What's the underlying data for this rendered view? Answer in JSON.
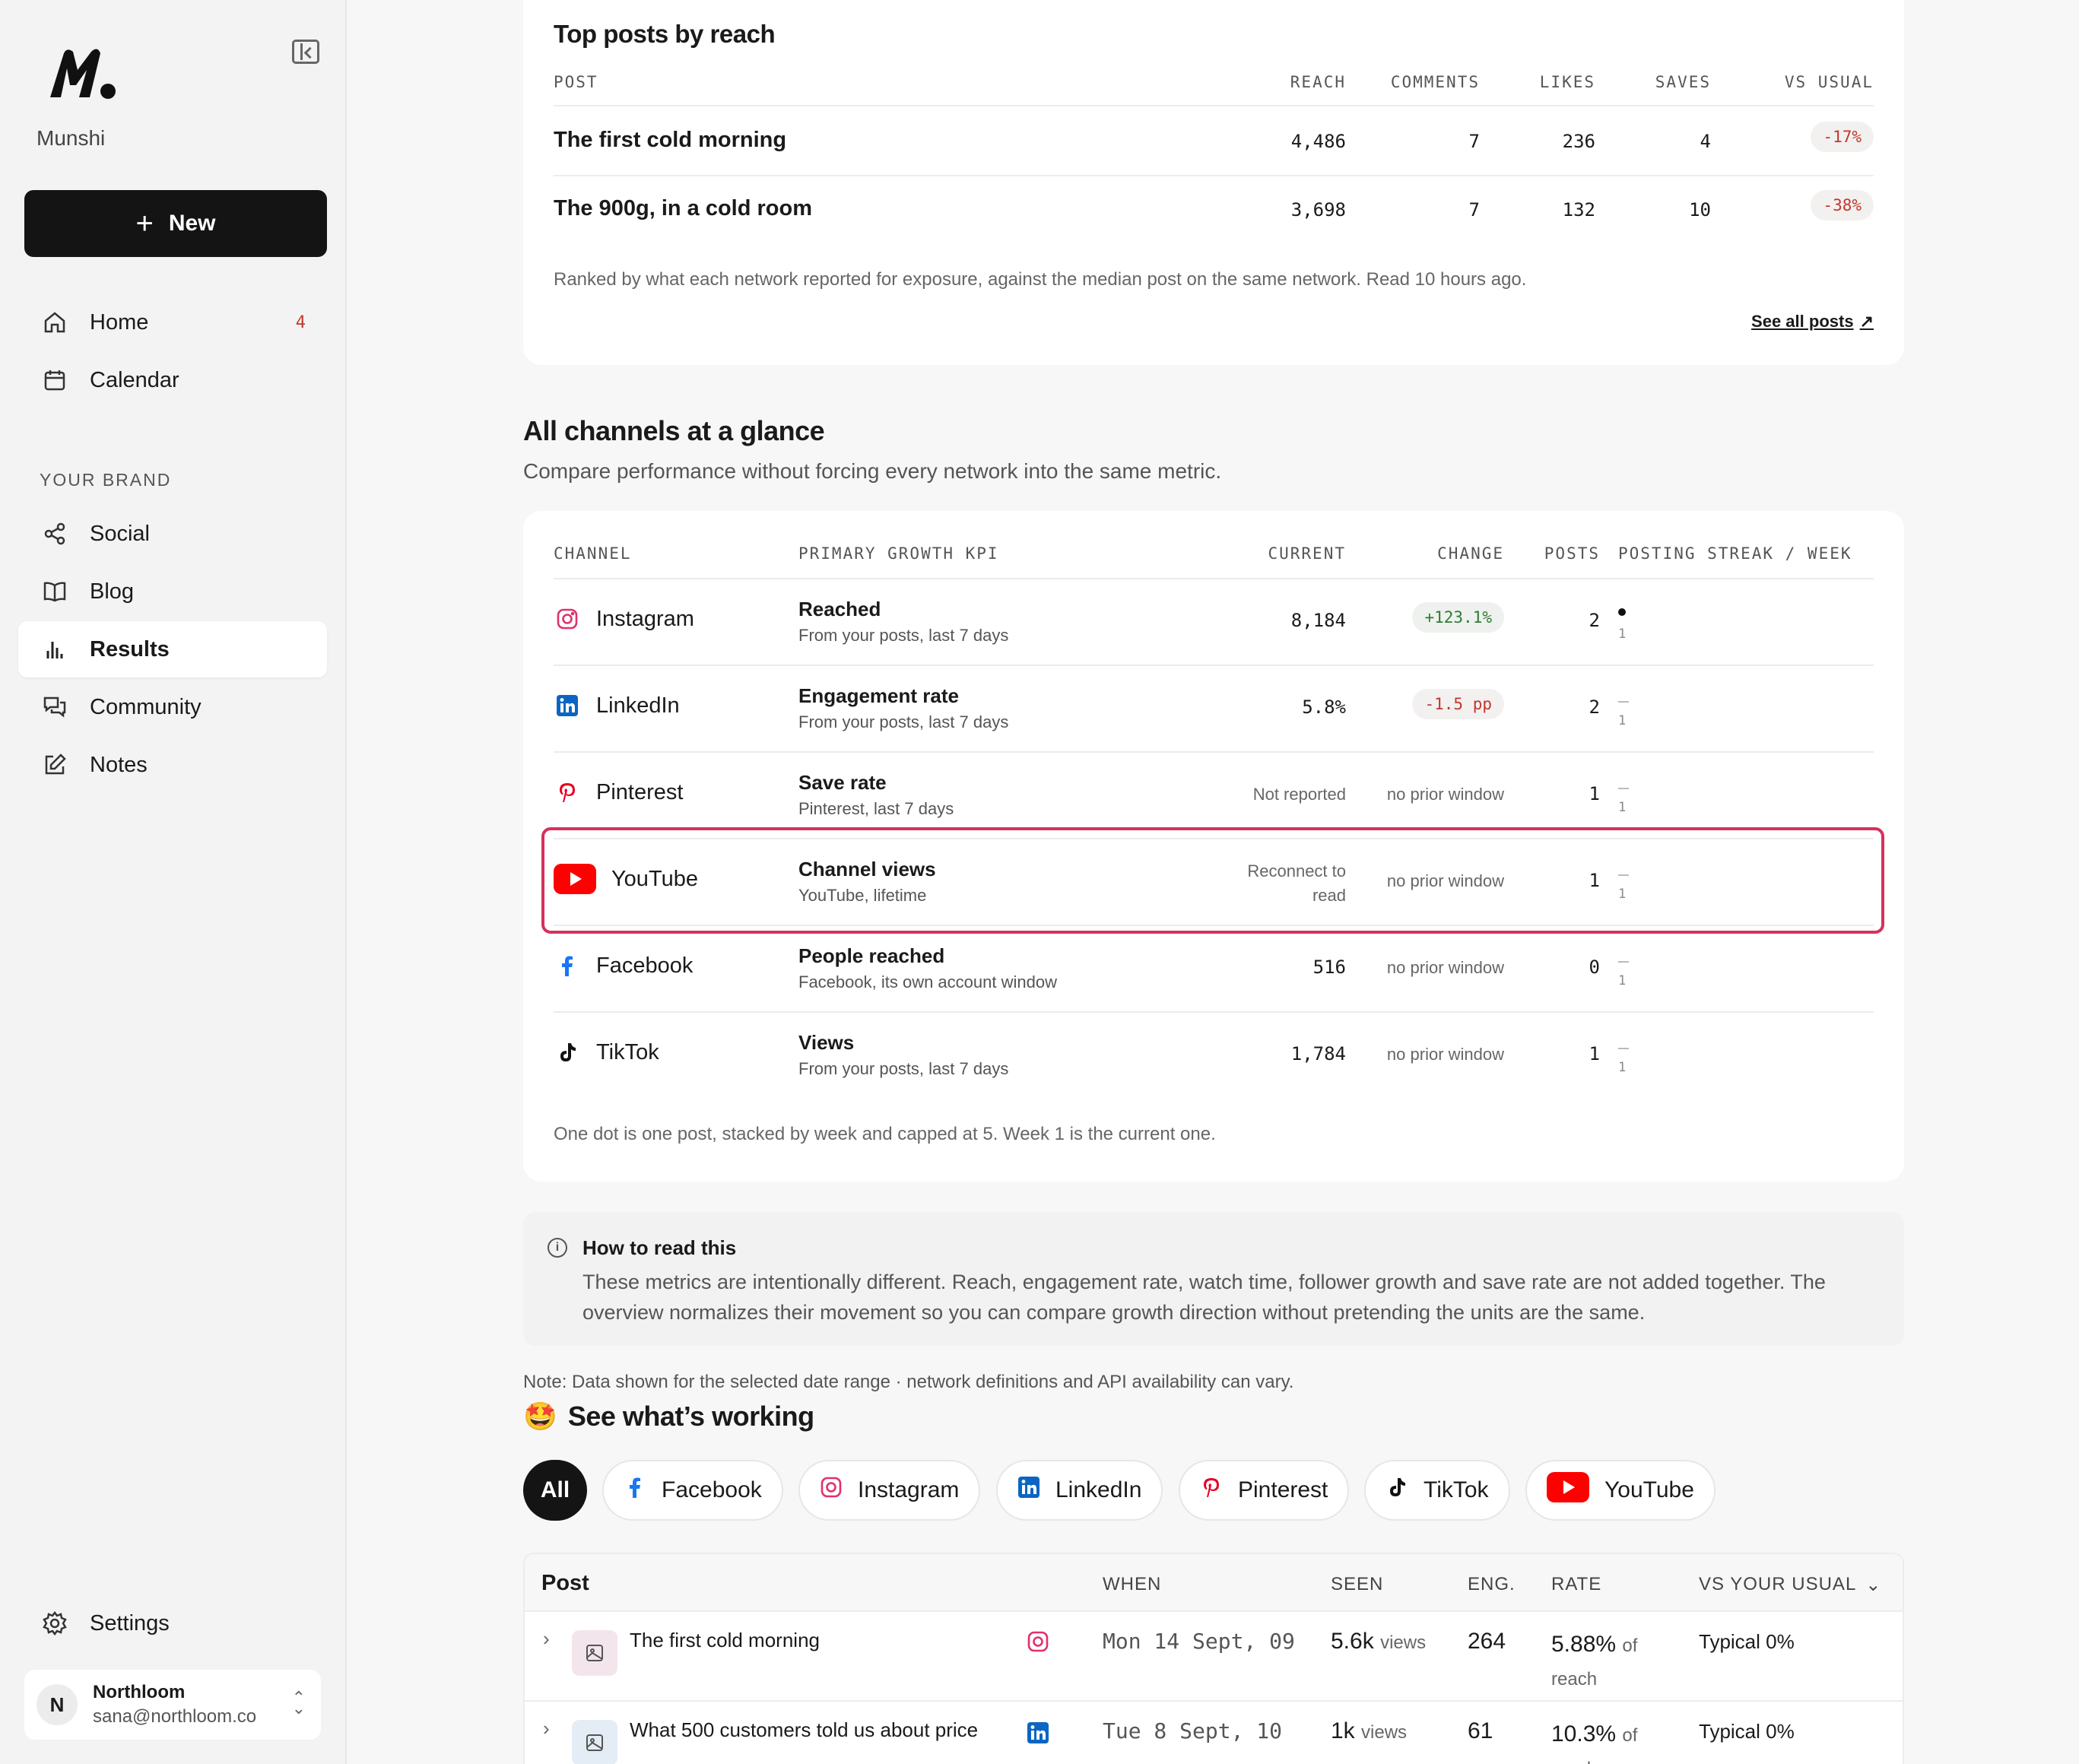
{
  "sidebar": {
    "brand": "Munshi",
    "new_label": "New",
    "nav": [
      {
        "label": "Home",
        "badge": "4"
      },
      {
        "label": "Calendar"
      }
    ],
    "section_label": "YOUR BRAND",
    "brand_nav": [
      {
        "label": "Social"
      },
      {
        "label": "Blog"
      },
      {
        "label": "Results"
      },
      {
        "label": "Community"
      },
      {
        "label": "Notes"
      }
    ],
    "settings_label": "Settings",
    "user": {
      "initial": "N",
      "name": "Northloom",
      "email": "sana@northloom.co"
    }
  },
  "top_posts": {
    "title": "Top posts by reach",
    "headers": [
      "POST",
      "REACH",
      "COMMENTS",
      "LIKES",
      "SAVES",
      "VS USUAL"
    ],
    "rows": [
      {
        "post": "The first cold morning",
        "reach": "4,486",
        "comments": "7",
        "likes": "236",
        "saves": "4",
        "vs": "-17%"
      },
      {
        "post": "The 900g, in a cold room",
        "reach": "3,698",
        "comments": "7",
        "likes": "132",
        "saves": "10",
        "vs": "-38%"
      }
    ],
    "footnote": "Ranked by what each network reported for exposure, against the median post on the same network. Read 10 hours ago.",
    "see_all": "See all posts"
  },
  "channels": {
    "title": "All channels at a glance",
    "subtitle": "Compare performance without forcing every network into the same metric.",
    "headers": [
      "CHANNEL",
      "PRIMARY GROWTH KPI",
      "CURRENT",
      "CHANGE",
      "POSTS",
      "POSTING STREAK / WEEK"
    ],
    "rows": [
      {
        "channel": "Instagram",
        "kpi": "Reached",
        "kpi_sub": "From your posts, last 7 days",
        "current": "8,184",
        "change": "+123.1%",
        "posts": "2",
        "week": "1",
        "streak_dots": 1
      },
      {
        "channel": "LinkedIn",
        "kpi": "Engagement rate",
        "kpi_sub": "From your posts, last 7 days",
        "current": "5.8%",
        "change": "-1.5 pp",
        "posts": "2",
        "week": "1",
        "streak_dots": 0
      },
      {
        "channel": "Pinterest",
        "kpi": "Save rate",
        "kpi_sub": "Pinterest, last 7 days",
        "current": "Not reported",
        "change": "no prior window",
        "posts": "1",
        "week": "1",
        "streak_dots": 0
      },
      {
        "channel": "YouTube",
        "kpi": "Channel views",
        "kpi_sub": "YouTube, lifetime",
        "current_l1": "Reconnect to",
        "current_l2": "read",
        "change": "no prior window",
        "posts": "1",
        "week": "1",
        "streak_dots": 0
      },
      {
        "channel": "Facebook",
        "kpi": "People reached",
        "kpi_sub": "Facebook, its own account window",
        "current": "516",
        "change": "no prior window",
        "posts": "0",
        "week": "1",
        "streak_dots": 0
      },
      {
        "channel": "TikTok",
        "kpi": "Views",
        "kpi_sub": "From your posts, last 7 days",
        "current": "1,784",
        "change": "no prior window",
        "posts": "1",
        "week": "1",
        "streak_dots": 0
      }
    ],
    "footnote": "One dot is one post, stacked by week and capped at 5. Week 1 is the current one."
  },
  "how_to_read": {
    "title": "How to read this",
    "body": "These metrics are intentionally different. Reach, engagement rate, watch time, follower growth and save rate are not added together. The overview normalizes their movement so you can compare growth direction without pretending the units are the same."
  },
  "note": "Note: Data shown for the selected date range · network definitions and API availability can vary.",
  "working": {
    "emoji": "🤩",
    "title": "See what’s working",
    "filters": [
      "All",
      "Facebook",
      "Instagram",
      "LinkedIn",
      "Pinterest",
      "TikTok",
      "YouTube"
    ],
    "headers": {
      "post": "Post",
      "when": "WHEN",
      "seen": "SEEN",
      "eng": "ENG.",
      "rate": "RATE",
      "vs": "VS YOUR USUAL"
    },
    "rows": [
      {
        "title": "The first cold morning",
        "network": "instagram",
        "when": "Mon 14 Sept, 09",
        "seen": "5.6k",
        "seen_unit": "views",
        "eng": "264",
        "rate": "5.88%",
        "rate_unit": "of",
        "rate_unit2": "reach",
        "vs": "Typical 0%"
      },
      {
        "title": "What 500 customers told us about price",
        "network": "linkedin",
        "when": "Tue 8 Sept, 10",
        "seen": "1k",
        "seen_unit": "views",
        "eng": "61",
        "rate": "10.3%",
        "rate_unit": "of",
        "rate_unit2": "reach",
        "vs": "Typical 0%"
      }
    ]
  },
  "colors": {
    "accent": "#141414",
    "highlight": "#d6315b",
    "negative": "#c0392b",
    "positive": "#2e7d32",
    "instagram": "#e1306c",
    "linkedin": "#0a66c2",
    "pinterest": "#e60023",
    "youtube": "#ff0000",
    "facebook": "#1877f2"
  }
}
